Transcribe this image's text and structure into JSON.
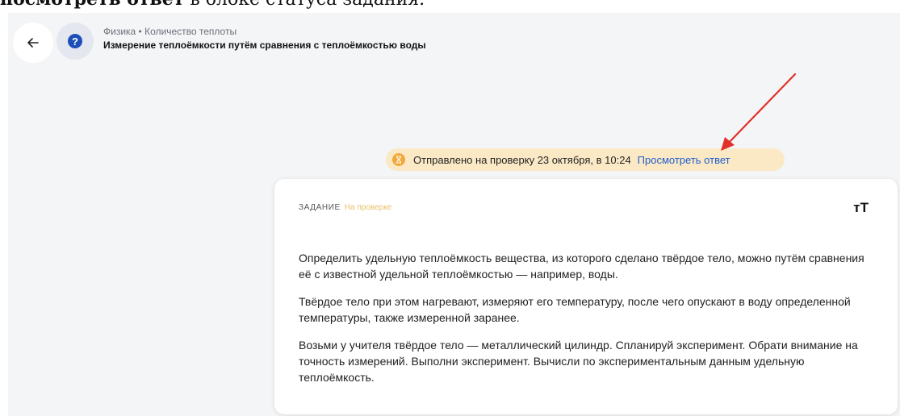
{
  "top_instruction": {
    "bold_part": "посмотреть ответ",
    "rest_part": " в блоке статуса задания."
  },
  "header": {
    "breadcrumb": "Физика • Количество теплоты",
    "title": "Измерение теплоёмкости путём сравнения с теплоёмкостью воды"
  },
  "status": {
    "text": "Отправлено на проверку 23 октября, в 10:24",
    "link_label": "Просмотреть ответ",
    "icon": "hourglass-icon"
  },
  "task": {
    "label": "ЗАДАНИЕ",
    "status": "На проверке",
    "font_size_label": "тT",
    "paragraphs": [
      "Определить удельную теплоёмкость вещества, из которого сделано твёрдое тело, можно путём сравнения её с известной удельной теплоёмкостью — например, воды.",
      "Твёрдое тело при этом нагревают, измеряют его температуру, после чего опускают в воду определенной температуры, также измеренной заранее.",
      "Возьми у учителя твёрдое тело — металлический цилиндр. Спланируй эксперимент. Обрати внимание на точность измерений. Выполни эксперимент. Вычисли по экспериментальным данным удельную теплоёмкость."
    ]
  },
  "colors": {
    "accent": "#1f5dcc",
    "status_bg": "#fbe9c6",
    "status_icon": "#f0a93a",
    "arrow": "#e0322b"
  }
}
